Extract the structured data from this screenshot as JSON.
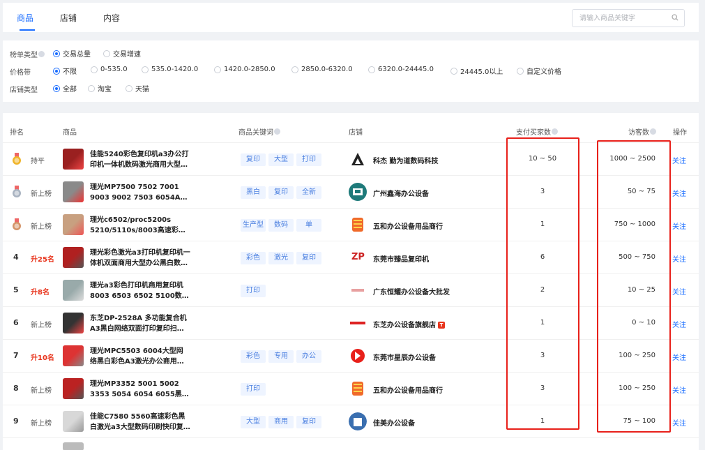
{
  "tabs": [
    "商品",
    "店铺",
    "内容"
  ],
  "search": {
    "placeholder": "请输入商品关键字"
  },
  "filters": {
    "ranking_type": {
      "label": "榜单类型",
      "options": [
        "交易总量",
        "交易增速"
      ]
    },
    "price_range": {
      "label": "价格带",
      "options": [
        "不限",
        "0-535.0",
        "535.0-1420.0",
        "1420.0-2850.0",
        "2850.0-6320.0",
        "6320.0-24445.0",
        "24445.0以上",
        "自定义价格"
      ]
    },
    "shop_type": {
      "label": "店铺类型",
      "options": [
        "全部",
        "淘宝",
        "天猫"
      ]
    }
  },
  "table": {
    "headers": {
      "rank": "排名",
      "product": "商品",
      "keywords": "商品关键词",
      "shop": "店铺",
      "buyers": "支付买家数",
      "visitors": "访客数",
      "action": "操作"
    },
    "follow_label": "关注",
    "rows": [
      {
        "rank": "",
        "change": "持平",
        "change_up": false,
        "name": [
          "佳能5240彩色复印机a3办公打",
          "印机一体机数码激光商用大型…"
        ],
        "keywords": [
          "复印",
          "大型",
          "打印"
        ],
        "shop": "科杰 勤为道数码科技",
        "buyers": "10 ~ 50",
        "visitors": "1000 ~ 2500"
      },
      {
        "rank": "",
        "change": "新上榜",
        "change_up": false,
        "name": [
          "理光MP7500 7502 7001",
          "9003 9002 7503 6054A…"
        ],
        "keywords": [
          "黑白",
          "复印",
          "全新"
        ],
        "shop": "广州鑫海办公设备",
        "buyers": "3",
        "visitors": "50 ~ 75"
      },
      {
        "rank": "",
        "change": "新上榜",
        "change_up": false,
        "name": [
          "理光c6502/proc5200s",
          "5210/5110s/8003高速彩…"
        ],
        "keywords": [
          "生产型",
          "数码",
          "单"
        ],
        "shop": "五和办公设备用品商行",
        "buyers": "1",
        "visitors": "750 ~ 1000"
      },
      {
        "rank": "4",
        "change": "升25名",
        "change_up": true,
        "name": [
          "理光彩色激光a3打印机复印机一",
          "体机双面商用大型办公黑白数…"
        ],
        "keywords": [
          "彩色",
          "激光",
          "复印"
        ],
        "shop": "东莞市臻品复印机",
        "buyers": "6",
        "visitors": "500 ~ 750"
      },
      {
        "rank": "5",
        "change": "升8名",
        "change_up": true,
        "name": [
          "理光a3彩色打印机商用复印机",
          "8003 6503 6502 5100数…"
        ],
        "keywords": [
          "打印"
        ],
        "shop": "广东恒耀办公设备大批发",
        "buyers": "2",
        "visitors": "10 ~ 25"
      },
      {
        "rank": "6",
        "change": "新上榜",
        "change_up": false,
        "name": [
          "东芝DP-2528A 多功能复合机",
          "A3黑白网络双面打印复印扫…"
        ],
        "keywords": [],
        "shop": "东芝办公设备旗舰店",
        "tmall": true,
        "buyers": "1",
        "visitors": "0 ~ 10"
      },
      {
        "rank": "7",
        "change": "升10名",
        "change_up": true,
        "name": [
          "理光MPC5503 6004大型网",
          "络黑白彩色A3激光办公商用…"
        ],
        "keywords": [
          "彩色",
          "专用",
          "办公"
        ],
        "shop": "东莞市星辰办公设备",
        "buyers": "3",
        "visitors": "100 ~ 250"
      },
      {
        "rank": "8",
        "change": "新上榜",
        "change_up": false,
        "name": [
          "理光MP3352 5001 5002",
          "3353 5054 6054 6055黑…"
        ],
        "keywords": [
          "打印"
        ],
        "shop": "五和办公设备用品商行",
        "buyers": "3",
        "visitors": "100 ~ 250"
      },
      {
        "rank": "9",
        "change": "新上榜",
        "change_up": false,
        "name": [
          "佳能C7580 5560高速彩色黑",
          "白激光a3大型数码印刷快印复…"
        ],
        "keywords": [
          "大型",
          "商用",
          "复印"
        ],
        "shop": "佳美办公设备",
        "buyers": "1",
        "visitors": "75 ~ 100"
      }
    ]
  },
  "colors": {
    "accent": "#1a6dff",
    "rise": "#e8341c",
    "highlight": "#e8201a",
    "tag_bg": "#eef4ff"
  },
  "icons": {
    "search": "search-icon",
    "medals": [
      "gold-medal-icon",
      "silver-medal-icon",
      "bronze-medal-icon"
    ]
  }
}
